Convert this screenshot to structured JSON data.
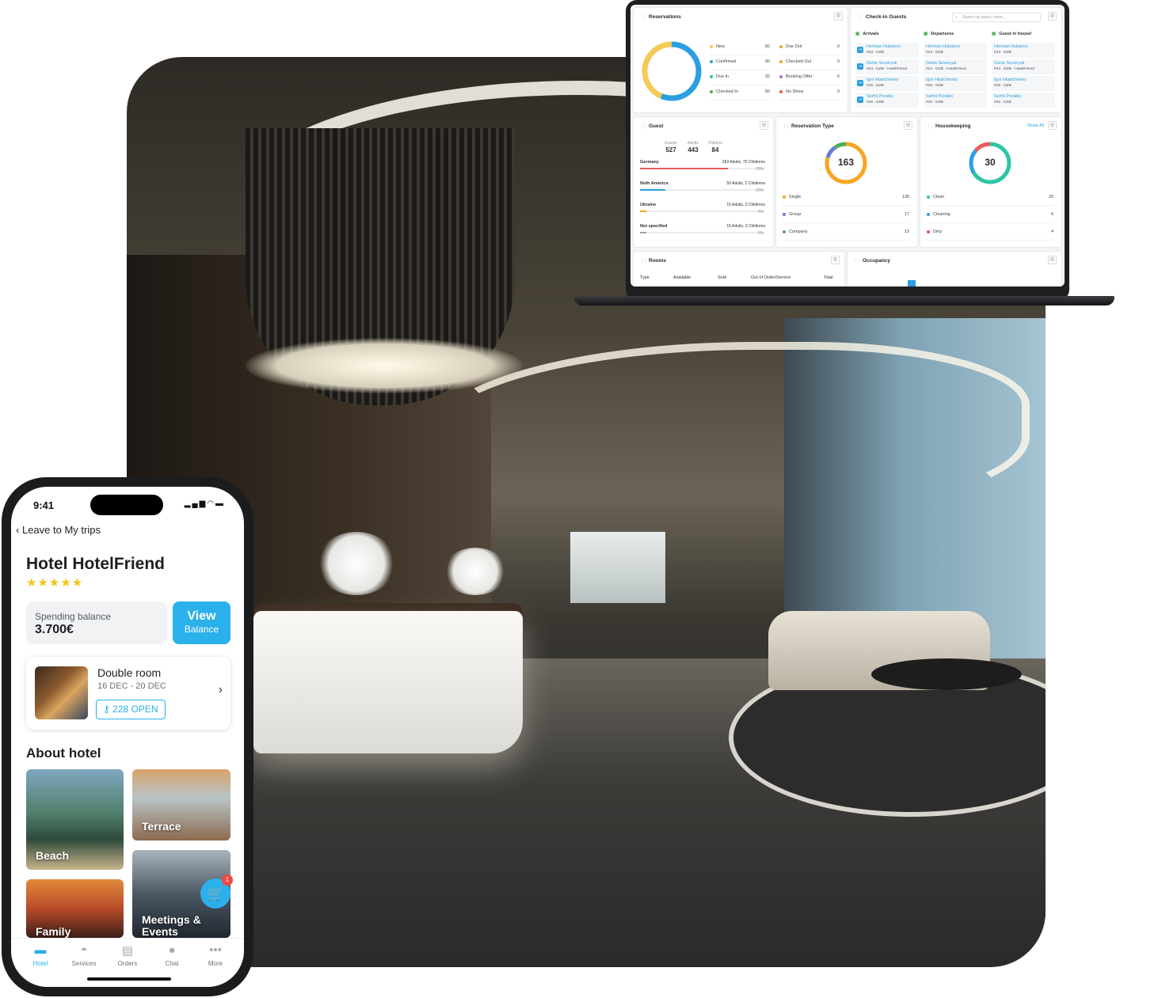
{
  "colors": {
    "accent": "#2ab0ea",
    "star": "#f5c518",
    "badge": "#f24a3b",
    "orange": "#f5a623",
    "donut_blue": "#2b9fe0",
    "donut_yellow": "#f5c95a",
    "teal": "#2ec4a6",
    "purple": "#6b7ad8",
    "green": "#4caf50",
    "red": "#e85a5a"
  },
  "dashboard": {
    "reservations": {
      "title": "Reservations",
      "items_left": [
        {
          "label": "New",
          "value": "60",
          "color": "#f5c95a"
        },
        {
          "label": "Confirmed",
          "value": "90",
          "color": "#2b9fe0"
        },
        {
          "label": "Due in",
          "value": "20",
          "color": "#2ec4a6"
        },
        {
          "label": "Checked In",
          "value": "50",
          "color": "#4caf50"
        }
      ],
      "items_right": [
        {
          "label": "Due Out",
          "value": "0",
          "color": "#f5a623"
        },
        {
          "label": "Checked Out",
          "value": "0",
          "color": "#f5a623"
        },
        {
          "label": "Booking Offer",
          "value": "0",
          "color": "#a86bd8"
        },
        {
          "label": "No Show",
          "value": "0",
          "color": "#e85a5a"
        }
      ]
    },
    "checkin": {
      "title": "Check-in Guests",
      "search_placeholder": "Search by guest, room...",
      "columns": [
        {
          "title": "Arrivals",
          "entries": [
            {
              "name": "Herman Hubanov",
              "sub": "#23 - DZB"
            },
            {
              "name": "Denis Severyuk",
              "sub": "#24 - DZB - HotelFriend"
            },
            {
              "name": "Igor Hladchenko",
              "sub": "#25 - DZB"
            },
            {
              "name": "Serhii Poraiko",
              "sub": "#26 - DZB"
            }
          ]
        },
        {
          "title": "Departures",
          "entries": [
            {
              "name": "Herman Hubanov",
              "sub": "#23 - DZB"
            },
            {
              "name": "Denis Severyuk",
              "sub": "#24 - DZB - HotelFriend"
            },
            {
              "name": "Igor Hladchenko",
              "sub": "#25 - DZB"
            },
            {
              "name": "Serhii Poraiko",
              "sub": "#26 - DZB"
            }
          ]
        },
        {
          "title": "Guest in house!",
          "entries": [
            {
              "name": "Herman Hubanov",
              "sub": "#23 - DZB"
            },
            {
              "name": "Denis Severyuk",
              "sub": "#24 - DZB - HotelFriend"
            },
            {
              "name": "Igor Hladchenko",
              "sub": "#25 - DZB"
            },
            {
              "name": "Serhii Poraiko",
              "sub": "#26 - DZB"
            }
          ]
        }
      ]
    },
    "guest": {
      "title": "Guest",
      "stats": [
        {
          "label": "Guests",
          "value": "527"
        },
        {
          "label": "Adults",
          "value": "443"
        },
        {
          "label": "Children",
          "value": "84"
        }
      ],
      "countries": [
        {
          "name": "Germany",
          "detail": "363 Adults, 76 Childrens",
          "percent": "70%",
          "fraction": 0.7,
          "color": "#e85a5a"
        },
        {
          "name": "Noth America",
          "detail": "50 Adults, 2 Childrens",
          "percent": "20%",
          "fraction": 0.2,
          "color": "#2b9fe0"
        },
        {
          "name": "Ukraine",
          "detail": "15 Adults, 3 Childrens",
          "percent": "5%",
          "fraction": 0.05,
          "color": "#f5a623"
        },
        {
          "name": "Not specified",
          "detail": "15 Adults, 3 Childrens",
          "percent": "5%",
          "fraction": 0.05,
          "color": "#9aa0a6"
        }
      ]
    },
    "reservation_type": {
      "title": "Reservation Type",
      "total": "163",
      "items": [
        {
          "label": "Single",
          "value": "130",
          "color": "#f5a623"
        },
        {
          "label": "Group",
          "value": "17",
          "color": "#6b7ad8"
        },
        {
          "label": "Company",
          "value": "13",
          "color": "#4caf50"
        }
      ]
    },
    "housekeeping": {
      "title": "Housekeeping",
      "show_all": "Show All",
      "total": "30",
      "items": [
        {
          "label": "Clean",
          "value": "20",
          "color": "#2ec4a6"
        },
        {
          "label": "Cleaning",
          "value": "6",
          "color": "#2b9fe0"
        },
        {
          "label": "Dirty",
          "value": "4",
          "color": "#e85a5a"
        }
      ]
    },
    "rooms": {
      "title": "Rooms",
      "columns": [
        "Type",
        "Available",
        "Sold",
        "Out of Order/Service",
        "Total"
      ]
    },
    "occupancy": {
      "title": "Occupancy"
    }
  },
  "phone": {
    "time": "9:41",
    "back_label": "Leave to My trips",
    "hotel_name": "Hotel HotelFriend",
    "stars": "★★★★★",
    "rating": 5,
    "balance_label": "Spending balance",
    "balance_value": "3.700€",
    "view_main": "View",
    "view_sub": "Balance",
    "room": {
      "name": "Double room",
      "dates": "16 DEC - 20 DEC",
      "open_label": "228 OPEN"
    },
    "about_title": "About hotel",
    "tiles": [
      {
        "label": "Beach"
      },
      {
        "label": "Terrace"
      },
      {
        "label": "Family"
      },
      {
        "label": "Meetings & Events"
      }
    ],
    "cart_count": "1",
    "tabs": [
      {
        "label": "Hotel",
        "icon": "bed-icon"
      },
      {
        "label": "Services",
        "icon": "bell-icon"
      },
      {
        "label": "Orders",
        "icon": "document-icon"
      },
      {
        "label": "Chat",
        "icon": "chat-icon"
      },
      {
        "label": "More",
        "icon": "more-icon"
      }
    ]
  }
}
